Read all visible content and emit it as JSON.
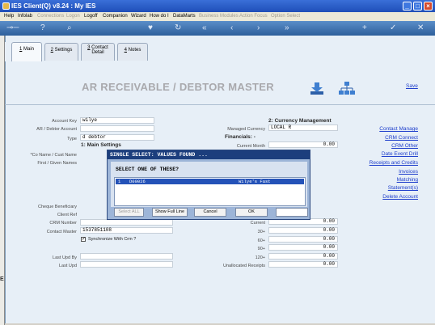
{
  "window": {
    "title": "IES Client(Q) v8.24 : My IES"
  },
  "menu": [
    {
      "label": "Help",
      "enabled": true
    },
    {
      "label": "Infolab",
      "enabled": true
    },
    {
      "label": "Connections",
      "enabled": false
    },
    {
      "label": "Logon",
      "enabled": false
    },
    {
      "label": "Logoff",
      "enabled": true
    },
    {
      "label": "Companion",
      "enabled": true
    },
    {
      "label": "Wizard",
      "enabled": true
    },
    {
      "label": "How do I",
      "enabled": true
    },
    {
      "label": "DataMarts",
      "enabled": true
    },
    {
      "label": "Business Modules",
      "enabled": false
    },
    {
      "label": "Action Focus",
      "enabled": false
    },
    {
      "label": "Option Select",
      "enabled": false
    }
  ],
  "tabs": [
    {
      "num": "1",
      "label": "Main",
      "active": true
    },
    {
      "num": "2",
      "label": "Settings",
      "active": false
    },
    {
      "num": "3",
      "label": "Contact",
      "label2": "Detail",
      "active": false
    },
    {
      "num": "4",
      "label": "Notes",
      "active": false
    }
  ],
  "header": {
    "title": "AR RECEIVABLE / DEBTOR MASTER",
    "save": "Save"
  },
  "form": {
    "account_key_label": "Account Key",
    "account_key": "wilye",
    "debtor_account_label": "AR / Debtor Account",
    "debtor_account": "",
    "type_label": "Type",
    "type": "d debtor",
    "main_settings": "1: Main Settings",
    "coname_label": "*Co Name / Cust Name",
    "first_label": "First / Given Names",
    "cheque_label": "Cheque Beneficiary",
    "client_ref_label": "Client Ref",
    "crm_number_label": "CRM Number",
    "contact_master_label": "Contact Master",
    "contact_master": "1537851108",
    "sync_label": "Synchronize With Crm ?",
    "sync_checked": true,
    "last_upd_by_label": "Last Upd By",
    "last_upd_label": "Last Upd"
  },
  "currency": {
    "section": "2: Currency Management",
    "managed_label": "Managed Currency",
    "managed_value": "LOCAL R",
    "financials": "Financials: -",
    "current_month_label": "Current Month",
    "current_month": "0.00",
    "rows": [
      {
        "label": "Current",
        "value": "0.00"
      },
      {
        "label": "30+",
        "value": "0.00"
      },
      {
        "label": "60+",
        "value": "0.00"
      },
      {
        "label": "90+",
        "value": "0.00"
      },
      {
        "label": "120+",
        "value": "0.00"
      },
      {
        "label": "Unallocated Receipts",
        "value": "0.00"
      }
    ]
  },
  "links": [
    "Contact Manage",
    "CRM Connect",
    "CRM Other",
    "Date Event Drill",
    "Receipts and Credits",
    "Invoices",
    "Matching",
    "Statement(s)",
    "Delete Account"
  ],
  "dialog": {
    "title": "SINGLE SELECT: VALUES FOUND ...",
    "prompt": "SELECT ONE OF THESE?",
    "row": {
      "index": "1",
      "code": "D00026",
      "name": "Wilye's Fast"
    },
    "buttons": {
      "select_all": "Select ALL",
      "show_full": "Show Full Line",
      "cancel": "Cancel",
      "ok": "OK"
    }
  },
  "colors": {
    "titlebar": "#1f4fb8",
    "accent_link": "#1f3fcc",
    "dialog_title": "#1c3e7d",
    "selected_row": "#2452b8"
  }
}
